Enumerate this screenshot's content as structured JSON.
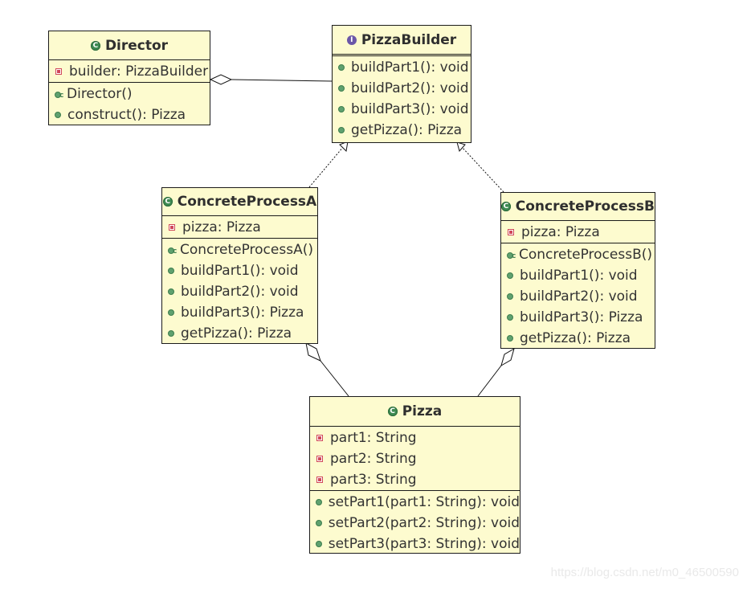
{
  "diagram": {
    "type": "UML class diagram",
    "classes": [
      {
        "id": "director",
        "name": "Director",
        "kind": "class",
        "attributes": [
          {
            "visibility": "private",
            "text": "builder: PizzaBuilder"
          }
        ],
        "methods": [
          {
            "visibility": "constructor",
            "text": "Director()"
          },
          {
            "visibility": "public",
            "text": "construct(): Pizza"
          }
        ]
      },
      {
        "id": "pizza-builder",
        "name": "PizzaBuilder",
        "kind": "interface",
        "attributes": [],
        "methods": [
          {
            "visibility": "public",
            "text": "buildPart1(): void"
          },
          {
            "visibility": "public",
            "text": "buildPart2(): void"
          },
          {
            "visibility": "public",
            "text": "buildPart3(): void"
          },
          {
            "visibility": "public",
            "text": "getPizza(): Pizza"
          }
        ]
      },
      {
        "id": "concrete-process-a",
        "name": "ConcreteProcessA",
        "kind": "class",
        "attributes": [
          {
            "visibility": "private",
            "text": "pizza: Pizza"
          }
        ],
        "methods": [
          {
            "visibility": "constructor",
            "text": "ConcreteProcessA()"
          },
          {
            "visibility": "public",
            "text": "buildPart1(): void"
          },
          {
            "visibility": "public",
            "text": "buildPart2(): void"
          },
          {
            "visibility": "public",
            "text": "buildPart3(): Pizza"
          },
          {
            "visibility": "public",
            "text": "getPizza(): Pizza"
          }
        ]
      },
      {
        "id": "concrete-process-b",
        "name": "ConcreteProcessB",
        "kind": "class",
        "attributes": [
          {
            "visibility": "private",
            "text": "pizza: Pizza"
          }
        ],
        "methods": [
          {
            "visibility": "constructor",
            "text": "ConcreteProcessB()"
          },
          {
            "visibility": "public",
            "text": "buildPart1(): void"
          },
          {
            "visibility": "public",
            "text": "buildPart2(): void"
          },
          {
            "visibility": "public",
            "text": "buildPart3(): Pizza"
          },
          {
            "visibility": "public",
            "text": "getPizza(): Pizza"
          }
        ]
      },
      {
        "id": "pizza",
        "name": "Pizza",
        "kind": "class",
        "attributes": [
          {
            "visibility": "private",
            "text": "part1: String"
          },
          {
            "visibility": "private",
            "text": "part2: String"
          },
          {
            "visibility": "private",
            "text": "part3: String"
          }
        ],
        "methods": [
          {
            "visibility": "public",
            "text": "setPart1(part1: String): void"
          },
          {
            "visibility": "public",
            "text": "setPart2(part2: String): void"
          },
          {
            "visibility": "public",
            "text": "setPart3(part3: String): void"
          }
        ]
      }
    ],
    "relationships": [
      {
        "type": "aggregation",
        "from": "director",
        "to": "pizza-builder"
      },
      {
        "type": "realization",
        "from": "concrete-process-a",
        "to": "pizza-builder"
      },
      {
        "type": "realization",
        "from": "concrete-process-b",
        "to": "pizza-builder"
      },
      {
        "type": "aggregation",
        "from": "concrete-process-a",
        "to": "pizza"
      },
      {
        "type": "aggregation",
        "from": "concrete-process-b",
        "to": "pizza"
      }
    ],
    "icons": {
      "class": "class-c-icon",
      "interface": "interface-i-icon",
      "private": "private-field-icon",
      "public": "public-method-icon",
      "constructor": "constructor-icon"
    },
    "colors": {
      "box_fill": "#fdfbcf",
      "border": "#1b1b1b",
      "class_icon": "#3e8a52",
      "interface_icon": "#6b57a8",
      "private_icon": "#d0485a",
      "public_icon": "#5fa16f"
    }
  },
  "watermark": "https://blog.csdn.net/m0_46500590"
}
